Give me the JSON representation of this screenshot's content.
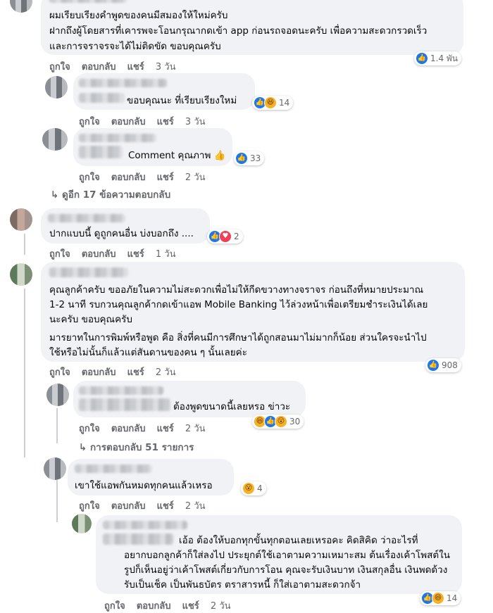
{
  "actions": {
    "like": "ถูกใจ",
    "reply": "ตอบกลับ",
    "share": "แชร์"
  },
  "comments": [
    {
      "lines": [
        "ผมเรียบเรียงคำพูดของคนมีสมองให้ใหม่ครับ",
        "ฝากถึงผู้โดยสารที่เคารพจะโอนกรุณากดเข้า app ก่อนรถจอดนะครับ  เพื่อความสะดวกรวดเร็ว",
        "และการจราจรจะได้ไม่ติดขัด ขอบคุณครับ"
      ],
      "time": "3 วัน",
      "reactions": "1.4 พัน"
    },
    {
      "lines": [
        "ขอบคุณนะ ที่เรียบเรียงใหม่"
      ],
      "time": "3 วัน",
      "reactions": "14"
    },
    {
      "lines": [
        "Comment คุณภาพ 👍"
      ],
      "time": "2 วัน",
      "reactions": "33"
    },
    {
      "lines": [
        "ปากแบบนี้ ดูถูกคนอื่น บ่งบอกถึง ...."
      ],
      "time": "1 วัน",
      "reactions": "2"
    },
    {
      "lines": [
        "คุณลูกค้าครับ ขออภัยในความไม่สะดวกเพื่อไม่ให้กีดขวางทางจราจร ก่อนถึงที่หมายประมาณ",
        "1-2 นาที รบกวนคุณลูกค้ากดเข้าแอพ Mobile Banking ไว้ล่วงหน้าเพื่อเตรียมชำระเงินได้เลย",
        "นะครับ ขอบคุณครับ",
        "",
        "มารยาทในการพิมพ์หรือพูด คือ สิ่งที่คนมีการศึกษาได้ถูกสอนมาไม่มากก็น้อย ส่วนใครจะนำไป",
        "ใช้หรือไม่นั้นก็แล้วแต่สันดานของคน ๆ นั้นเลยค่ะ"
      ],
      "time": "2 วัน",
      "reactions": "908"
    },
    {
      "lines": [
        "ต้องพูดขนาดนี้เลยหรอ ข่าวะ"
      ],
      "time": "2 วัน",
      "reactions": "30"
    },
    {
      "lines": [
        "เขาใช้แอพกันหมดทุกคนแล้วเหรอ"
      ],
      "time": "2 วัน",
      "reactions": "4"
    },
    {
      "lines": [
        "เอ้อ ต้องให้บอกทุกขั้นทุกตอนเลยเหรอคะ คิดสิคิด ว่าอะไรที่",
        "อยากบอกลูกค้าก็ใส่ลงไป ประยุกต์ใช้เอาตามความเหมาะสม ต้นเรื่องเค้าโพสต์ใน",
        "รูปก็เห็นอยู่ว่าเค้าโพสต์เกี่ยวกับการโอน คุณจะรับเงินบาท เงินสกุลอื่น เงินพดด้วง",
        "รับเป็นเช็ค เป็นพันธบัตร ตราสารหนี้ ก็ใส่เอาตามสะดวกจ้า"
      ],
      "time": "2 วัน",
      "reactions": "14"
    }
  ],
  "more_replies_1": "↳ ดูอีก 17 ข้อความตอบกลับ",
  "more_replies_2": "↳ การตอบกลับ 51 รายการ",
  "icons": {
    "like": "like-icon",
    "haha": "haha-icon",
    "wow": "wow-icon",
    "love": "love-icon"
  }
}
